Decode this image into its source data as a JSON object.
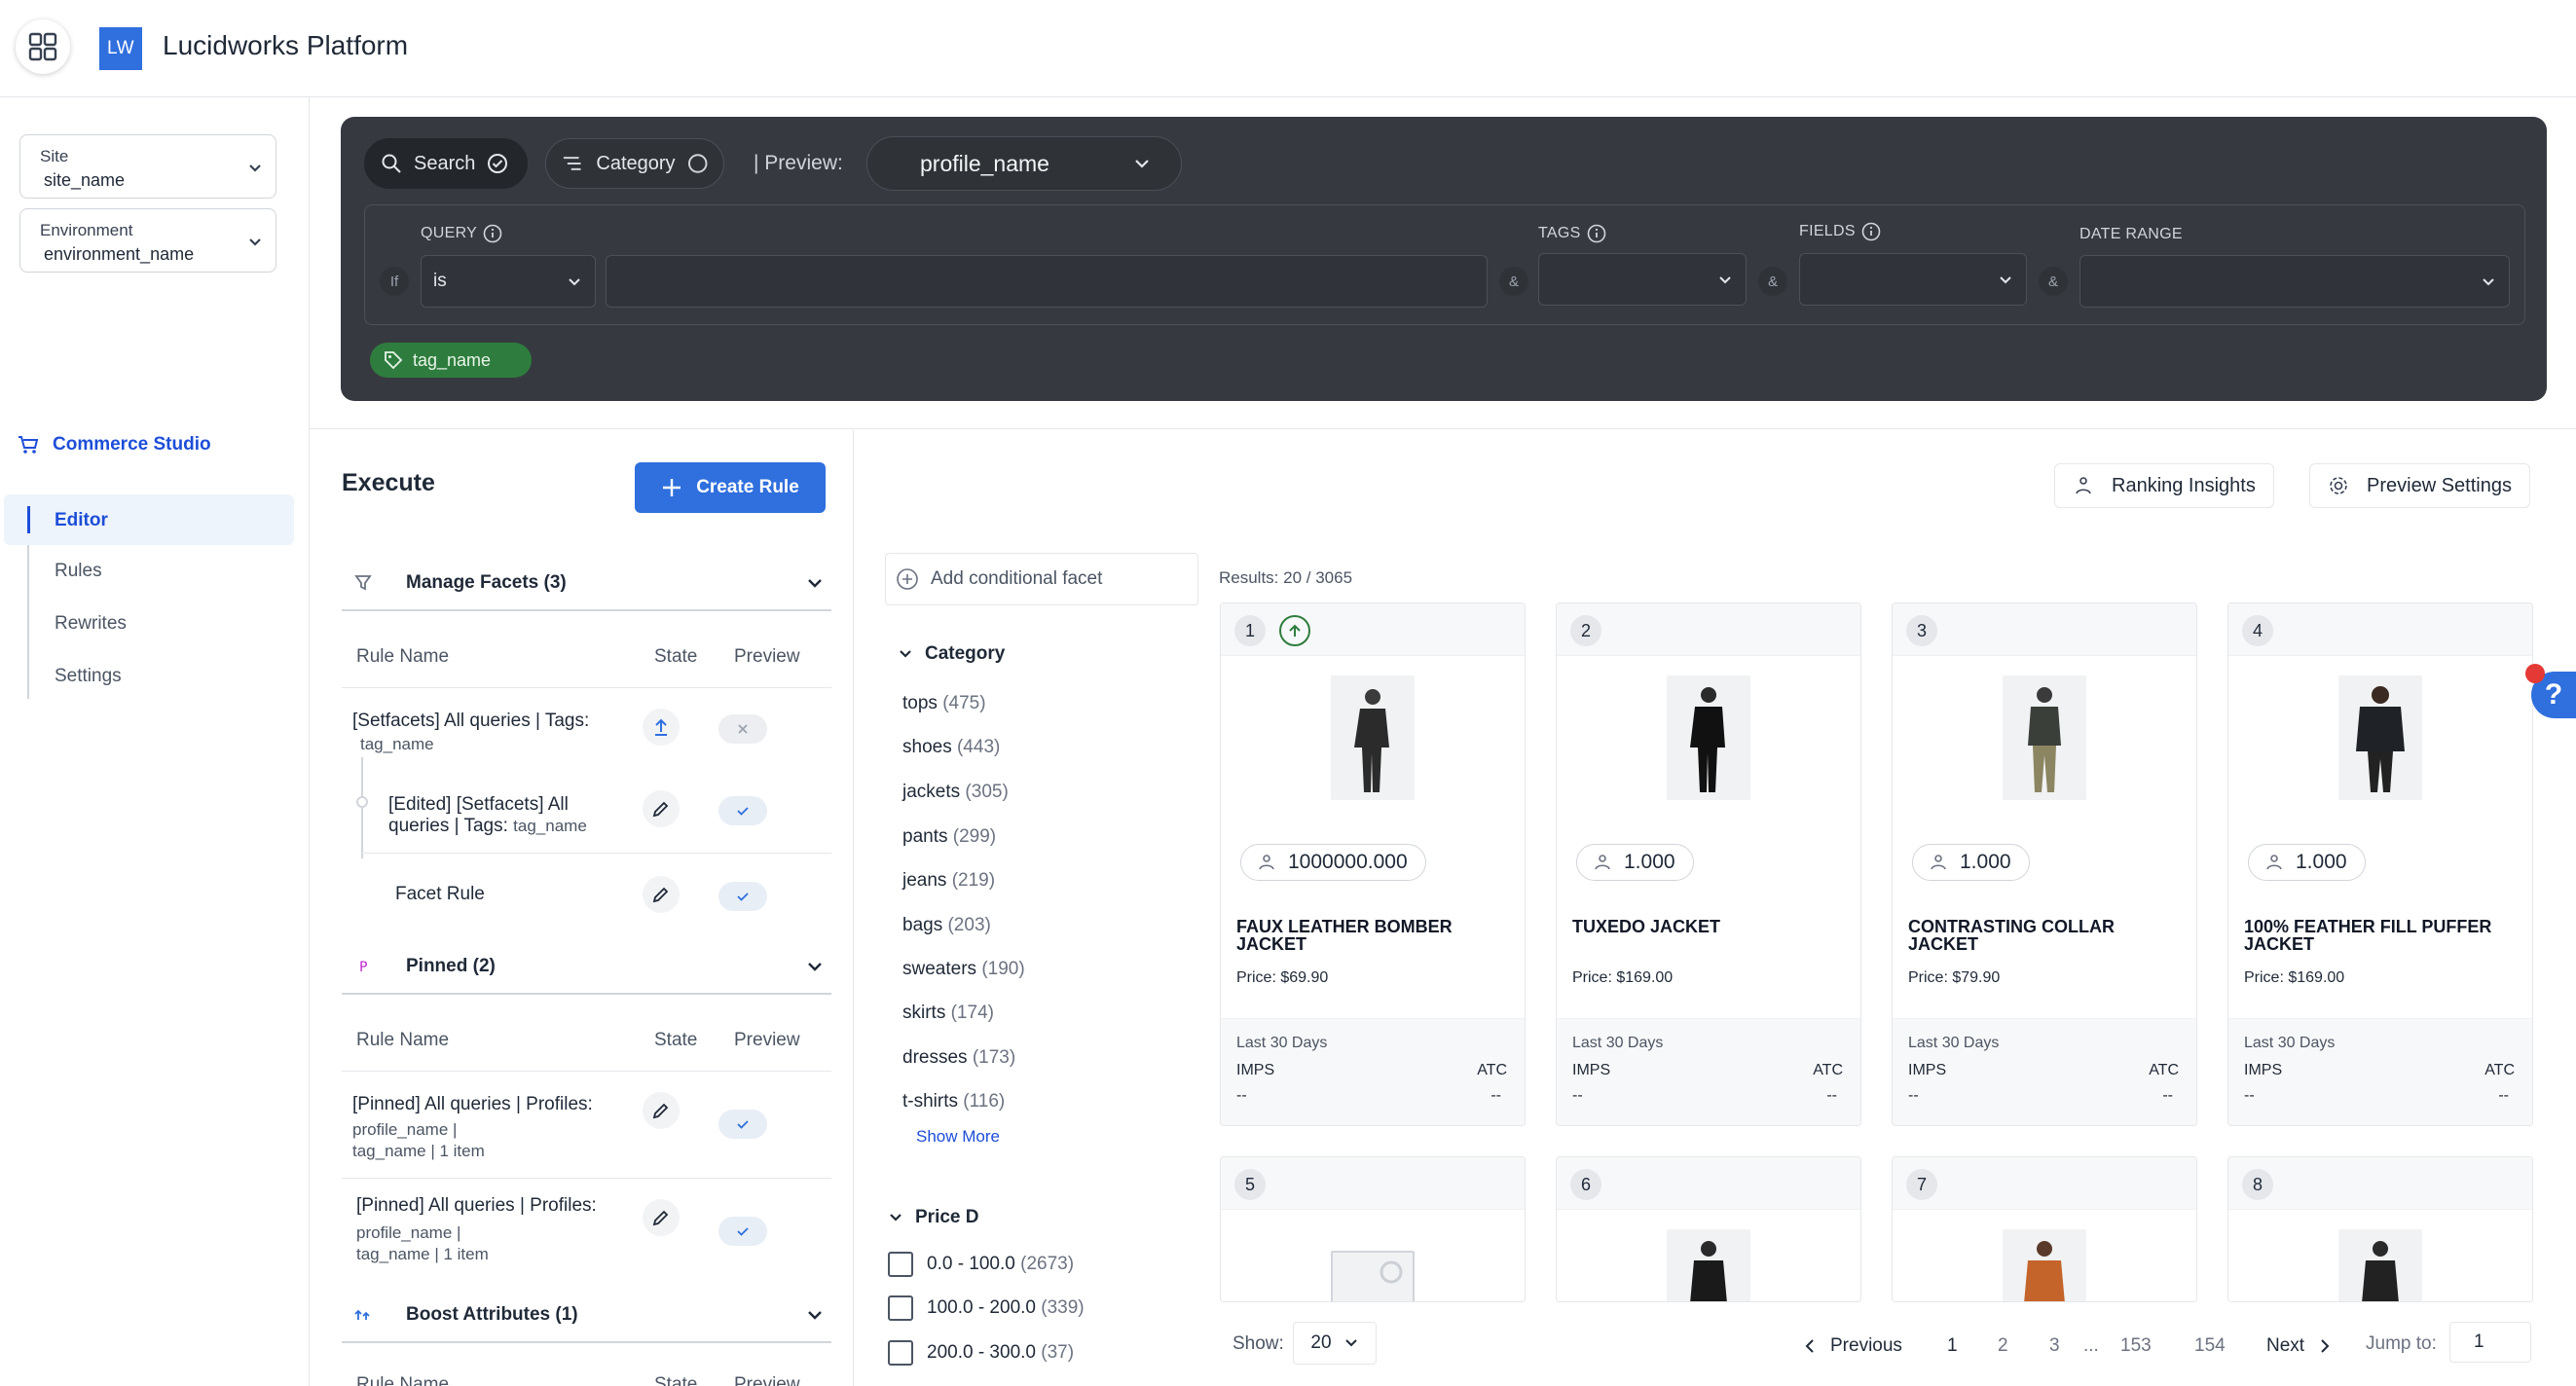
{
  "app": {
    "logo_text": "LW",
    "title": "Lucidworks Platform"
  },
  "sidebar": {
    "site": {
      "label": "Site",
      "value": "site_name"
    },
    "environment": {
      "label": "Environment",
      "value": "environment_name"
    },
    "studio_label": "Commerce Studio",
    "items": [
      {
        "label": "Editor",
        "active": true
      },
      {
        "label": "Rules",
        "active": false
      },
      {
        "label": "Rewrites",
        "active": false
      },
      {
        "label": "Settings",
        "active": false
      }
    ]
  },
  "query_panel": {
    "search_pill": "Search",
    "category_pill": "Category",
    "preview_label": "| Preview:",
    "profile_value": "profile_name",
    "headers": {
      "query": "QUERY",
      "tags": "TAGS",
      "fields": "FIELDS",
      "date_range": "DATE RANGE"
    },
    "if_label": "If",
    "operator_value": "is",
    "query_value": "",
    "amp": "&",
    "tag_chip": "tag_name"
  },
  "execute": {
    "title": "Execute",
    "create_rule_label": "Create Rule",
    "sections": {
      "facets": {
        "title": "Manage Facets (3)",
        "col_rule": "Rule Name",
        "col_state": "State",
        "col_preview": "Preview",
        "rows": [
          {
            "title": "[Setfacets] All queries | Tags:",
            "sub": "tag_name"
          },
          {
            "title_1": "[Edited] [Setfacets] All",
            "title_2": "queries | Tags:",
            "sub": "tag_name"
          },
          {
            "title": "Facet Rule"
          }
        ]
      },
      "pinned": {
        "title": "Pinned (2)",
        "col_rule": "Rule Name",
        "col_state": "State",
        "col_preview": "Preview",
        "rows": [
          {
            "title": "[Pinned] All queries | Profiles:",
            "sub_1": "profile_name |",
            "sub_2": "tag_name | 1 item"
          },
          {
            "title": "[Pinned] All queries | Profiles:",
            "sub_1": "profile_name |",
            "sub_2": "tag_name | 1 item"
          }
        ]
      },
      "boost": {
        "title": "Boost Attributes (1)",
        "col_rule": "Rule Name",
        "col_state": "State",
        "col_preview": "Preview"
      }
    }
  },
  "facets": {
    "add_label": "Add conditional facet",
    "category_title": "Category",
    "category_items": [
      {
        "name": "tops",
        "count": "(475)"
      },
      {
        "name": "shoes",
        "count": "(443)"
      },
      {
        "name": "jackets",
        "count": "(305)"
      },
      {
        "name": "pants",
        "count": "(299)"
      },
      {
        "name": "jeans",
        "count": "(219)"
      },
      {
        "name": "bags",
        "count": "(203)"
      },
      {
        "name": "sweaters",
        "count": "(190)"
      },
      {
        "name": "skirts",
        "count": "(174)"
      },
      {
        "name": "dresses",
        "count": "(173)"
      },
      {
        "name": "t-shirts",
        "count": "(116)"
      }
    ],
    "show_more": "Show More",
    "price_title": "Price D",
    "price_items": [
      {
        "range": "0.0 - 100.0",
        "count": "(2673)"
      },
      {
        "range": "100.0 - 200.0",
        "count": "(339)"
      },
      {
        "range": "200.0 - 300.0",
        "count": "(37)"
      }
    ]
  },
  "results": {
    "ranking_insights": "Ranking Insights",
    "preview_settings": "Preview Settings",
    "count_label": "Results: 20 / 3065",
    "cards": [
      {
        "num": "1",
        "score": "1000000.000",
        "title_1": "FAUX LEATHER BOMBER",
        "title_2": "JACKET",
        "price": "Price: $69.90"
      },
      {
        "num": "2",
        "score": "1.000",
        "title_1": "TUXEDO JACKET",
        "title_2": "",
        "price": "Price: $169.00"
      },
      {
        "num": "3",
        "score": "1.000",
        "title_1": "CONTRASTING COLLAR",
        "title_2": "JACKET",
        "price": "Price: $79.90"
      },
      {
        "num": "4",
        "score": "1.000",
        "title_1": "100% FEATHER FILL PUFFER",
        "title_2": "JACKET",
        "price": "Price: $169.00"
      },
      {
        "num": "5"
      },
      {
        "num": "6"
      },
      {
        "num": "7"
      },
      {
        "num": "8"
      }
    ],
    "stats": {
      "period": "Last 30 Days",
      "imps": "IMPS",
      "atc": "ATC",
      "empty": "--"
    }
  },
  "pagination": {
    "show_label": "Show:",
    "show_value": "20",
    "previous": "Previous",
    "pages": [
      "1",
      "2",
      "3",
      "...",
      "153",
      "154"
    ],
    "next": "Next",
    "jump_label": "Jump to:",
    "jump_value": "1"
  },
  "help": {
    "label": "?"
  },
  "colors": {
    "accent": "#2f6fde",
    "panel": "#363a40",
    "tag": "#2f7d3e"
  }
}
